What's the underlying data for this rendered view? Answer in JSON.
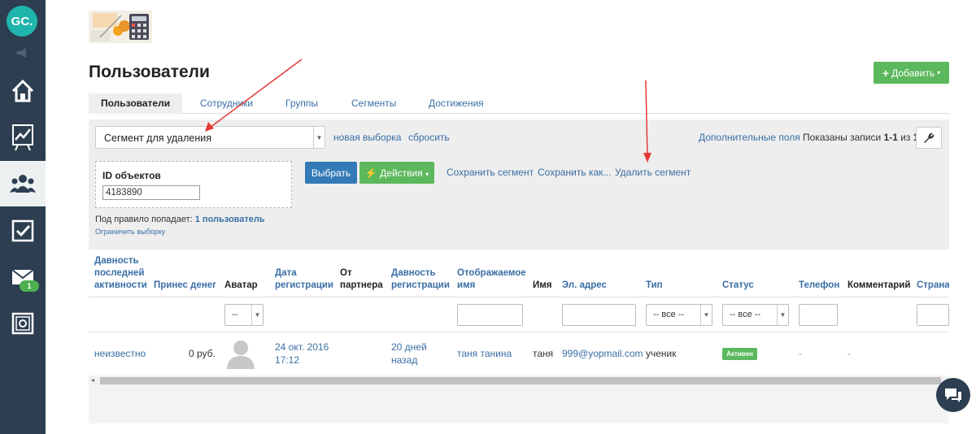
{
  "sidebar": {
    "logo_text": "GC.",
    "nav": [
      {
        "icon": "home-icon"
      },
      {
        "icon": "chart-icon"
      },
      {
        "icon": "users-icon",
        "active": true
      },
      {
        "icon": "checkbox-icon"
      },
      {
        "icon": "mail-icon",
        "badge": "1"
      },
      {
        "icon": "safe-icon"
      }
    ]
  },
  "header": {
    "title": "Пользователи",
    "add_button": "Добавить"
  },
  "tabs": [
    "Пользователи",
    "Сотрудники",
    "Группы",
    "Сегменты",
    "Достижения"
  ],
  "filter": {
    "segment_value": "Сегмент для удаления",
    "new_selection": "новая выборка",
    "reset": "сбросить",
    "extra_fields": "Дополнительные поля",
    "shown_prefix": "Показаны записи ",
    "shown_range": "1-1",
    "shown_of": " из ",
    "shown_total": "1",
    "shown_suffix": ".",
    "id_label": "ID объектов",
    "id_value": "4183890",
    "select_button": "Выбрать",
    "actions_button": "Действия",
    "save_segment": "Сохранить сегмент",
    "save_as": "Сохранить как...",
    "delete_segment": "Удалить сегмент",
    "rule_prefix": "Под правило попадает: ",
    "rule_count": "1 пользователь",
    "limit_link": "Ограничить выборку"
  },
  "table": {
    "headers": {
      "last_activity": "Давность последней активности",
      "money": "Принес денег",
      "avatar": "Аватар",
      "reg_date": "Дата регистрации",
      "partner": "От партнера",
      "reg_age": "Давность регистрации",
      "display_name": "Отображаемое имя",
      "name": "Имя",
      "email": "Эл. адрес",
      "type": "Тип",
      "status": "Статус",
      "phone": "Телефон",
      "comment": "Комментарий",
      "country": "Страна"
    },
    "filters": {
      "avatar_select": "--",
      "type_select": "-- все --",
      "status_select": "-- все --"
    },
    "row": {
      "last_activity": "неизвестно",
      "money": "0 руб.",
      "reg_date_line1": "24 окт. 2016",
      "reg_date_line2": "17:12",
      "reg_age_line1": "20 дней",
      "reg_age_line2": "назад",
      "display_name": "таня танина",
      "name": "таня",
      "email": "999@yopmail.com",
      "type": "ученик",
      "status": "Активен",
      "phone": "-",
      "comment": "-"
    }
  },
  "colors": {
    "sidebar_bg": "#2c3e50",
    "link": "#3a6ea5",
    "green": "#5cb85c",
    "blue": "#337ab7",
    "annotation_arrow": "#e53935"
  }
}
